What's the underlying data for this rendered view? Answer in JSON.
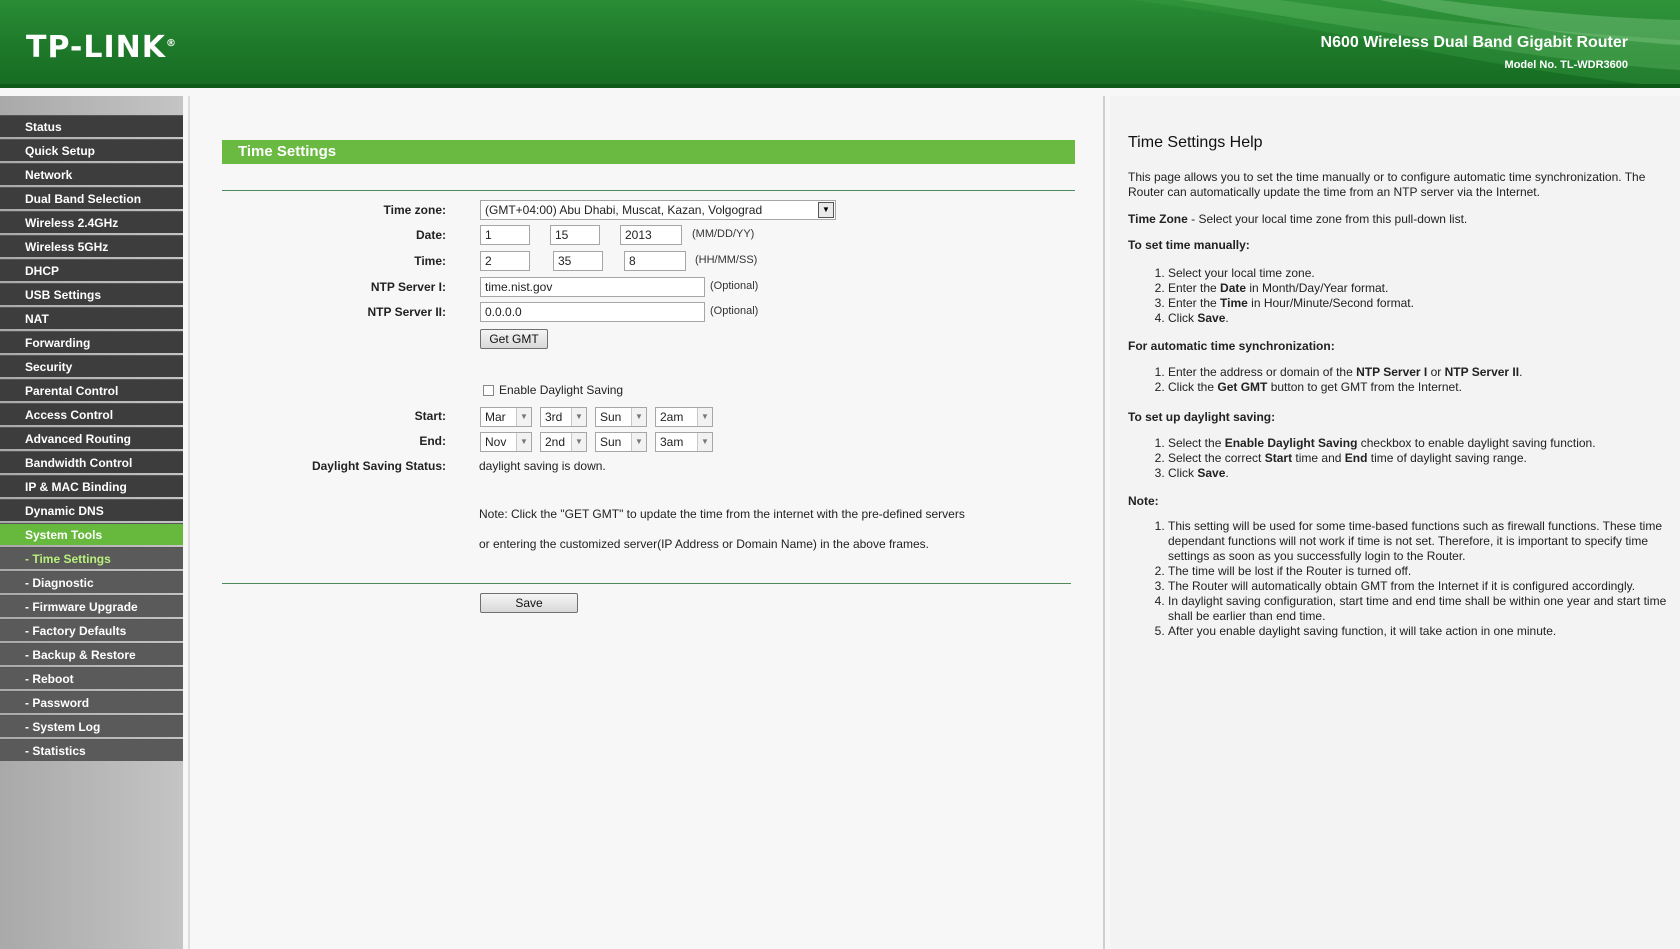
{
  "header": {
    "logo": "TP-LINK",
    "logo_mark": "®",
    "product": "N600 Wireless Dual Band Gigabit Router",
    "model": "Model No. TL-WDR3600",
    "brand_green": "#1e7a2a"
  },
  "sidebar": {
    "items": [
      {
        "label": "Status"
      },
      {
        "label": "Quick Setup"
      },
      {
        "label": "Network"
      },
      {
        "label": "Dual Band Selection"
      },
      {
        "label": "Wireless 2.4GHz"
      },
      {
        "label": "Wireless 5GHz"
      },
      {
        "label": "DHCP"
      },
      {
        "label": "USB Settings"
      },
      {
        "label": "NAT"
      },
      {
        "label": "Forwarding"
      },
      {
        "label": "Security"
      },
      {
        "label": "Parental Control"
      },
      {
        "label": "Access Control"
      },
      {
        "label": "Advanced Routing"
      },
      {
        "label": "Bandwidth Control"
      },
      {
        "label": "IP & MAC Binding"
      },
      {
        "label": "Dynamic DNS"
      },
      {
        "label": "System Tools"
      },
      {
        "label": "- Time Settings"
      },
      {
        "label": "- Diagnostic"
      },
      {
        "label": "- Firmware Upgrade"
      },
      {
        "label": "- Factory Defaults"
      },
      {
        "label": "- Backup & Restore"
      },
      {
        "label": "- Reboot"
      },
      {
        "label": "- Password"
      },
      {
        "label": "- System Log"
      },
      {
        "label": "- Statistics"
      }
    ]
  },
  "main": {
    "title": "Time Settings",
    "timezone_label": "Time zone:",
    "timezone_value": "(GMT+04:00) Abu Dhabi, Muscat, Kazan, Volgograd",
    "date_label": "Date:",
    "date_month": "1",
    "date_day": "15",
    "date_year": "2013",
    "date_hint": "(MM/DD/YY)",
    "time_label": "Time:",
    "time_hour": "2",
    "time_min": "35",
    "time_sec": "8",
    "time_hint": "(HH/MM/SS)",
    "ntp1_label": "NTP Server I:",
    "ntp1_value": "time.nist.gov",
    "ntp2_label": "NTP Server II:",
    "ntp2_value": "0.0.0.0",
    "optional": "(Optional)",
    "get_gmt": "Get GMT",
    "dst_checkbox": "Enable Daylight Saving",
    "start_label": "Start:",
    "start_month": "Mar",
    "start_week": "3rd",
    "start_day": "Sun",
    "start_hour": "2am",
    "end_label": "End:",
    "end_month": "Nov",
    "end_week": "2nd",
    "end_day": "Sun",
    "end_hour": "3am",
    "dst_status_label": "Daylight Saving Status:",
    "dst_status_value": "daylight saving is down.",
    "note_line1": "Note: Click the \"GET GMT\" to update the time from the internet with the pre-defined servers",
    "note_line2": "or entering the customized server(IP Address or Domain Name) in the above frames.",
    "save": "Save"
  },
  "help": {
    "title": "Time Settings Help",
    "intro": "This page allows you to set the time manually or to configure automatic time synchronization. The Router can automatically update the time from an NTP server via the Internet.",
    "timezone_bold": "Time Zone",
    "timezone_text": " - Select your local time zone from this pull-down list.",
    "manual_hdr": "To set time manually:",
    "manual_steps": [
      [
        "Select your local time zone.",
        "",
        ""
      ],
      [
        "Enter the ",
        "Date",
        " in Month/Day/Year format."
      ],
      [
        "Enter the ",
        "Time",
        " in Hour/Minute/Second format."
      ],
      [
        "Click ",
        "Save",
        "."
      ]
    ],
    "auto_hdr": "For automatic time synchronization:",
    "auto_steps": [
      [
        "Enter the address or domain of the ",
        "NTP Server I",
        " or ",
        "NTP Server II",
        "."
      ],
      [
        "Click the ",
        "Get GMT",
        " button to get GMT from the Internet.",
        "",
        ""
      ]
    ],
    "dst_hdr": "To set up daylight saving:",
    "dst_steps": [
      [
        "Select the ",
        "Enable Daylight Saving",
        " checkbox to enable daylight saving function.",
        "",
        ""
      ],
      [
        "Select the correct ",
        "Start",
        " time and ",
        "End",
        " time of daylight saving range."
      ],
      [
        "Click ",
        "Save",
        ".",
        "",
        ""
      ]
    ],
    "note_hdr": "Note:",
    "notes": [
      "This setting will be used for some time-based functions such as firewall functions. These time dependant functions will not work if time is not set. Therefore, it is important to specify time settings as soon as you successfully login to the Router.",
      "The time will be lost if the Router is turned off.",
      "The Router will automatically obtain GMT from the Internet if it is configured accordingly.",
      "In daylight saving configuration, start time and end time shall be within one year and start time shall be earlier than end time.",
      "After you enable daylight saving function, it will take action in one minute."
    ]
  }
}
